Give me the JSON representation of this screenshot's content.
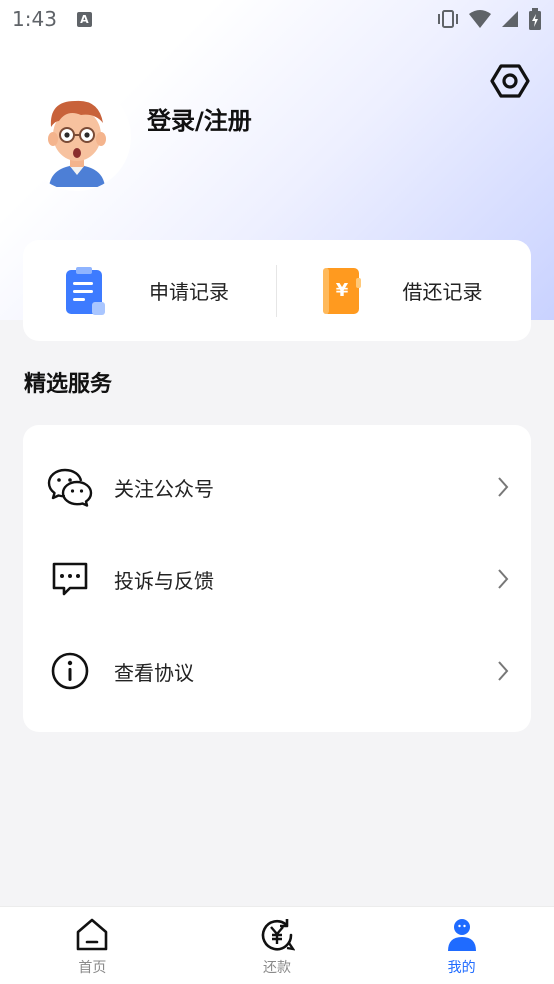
{
  "status_bar": {
    "time": "1:43",
    "notification_glyph": "A"
  },
  "header": {
    "login_text": "登录/注册"
  },
  "records": [
    {
      "label": "申请记录",
      "icon": "clipboard-icon"
    },
    {
      "label": "借还记录",
      "icon": "yuan-notebook-icon"
    }
  ],
  "services": {
    "title": "精选服务",
    "items": [
      {
        "label": "关注公众号",
        "icon": "wechat-icon"
      },
      {
        "label": "投诉与反馈",
        "icon": "feedback-message-icon"
      },
      {
        "label": "查看协议",
        "icon": "info-icon"
      }
    ]
  },
  "tabbar": {
    "tabs": [
      {
        "label": "首页",
        "icon": "home-icon"
      },
      {
        "label": "还款",
        "icon": "repay-icon"
      },
      {
        "label": "我的",
        "icon": "profile-icon",
        "active": true
      }
    ]
  },
  "colors": {
    "accent": "#1f6bff",
    "record_blue": "#3d7bff",
    "record_orange": "#ff9a1f"
  }
}
